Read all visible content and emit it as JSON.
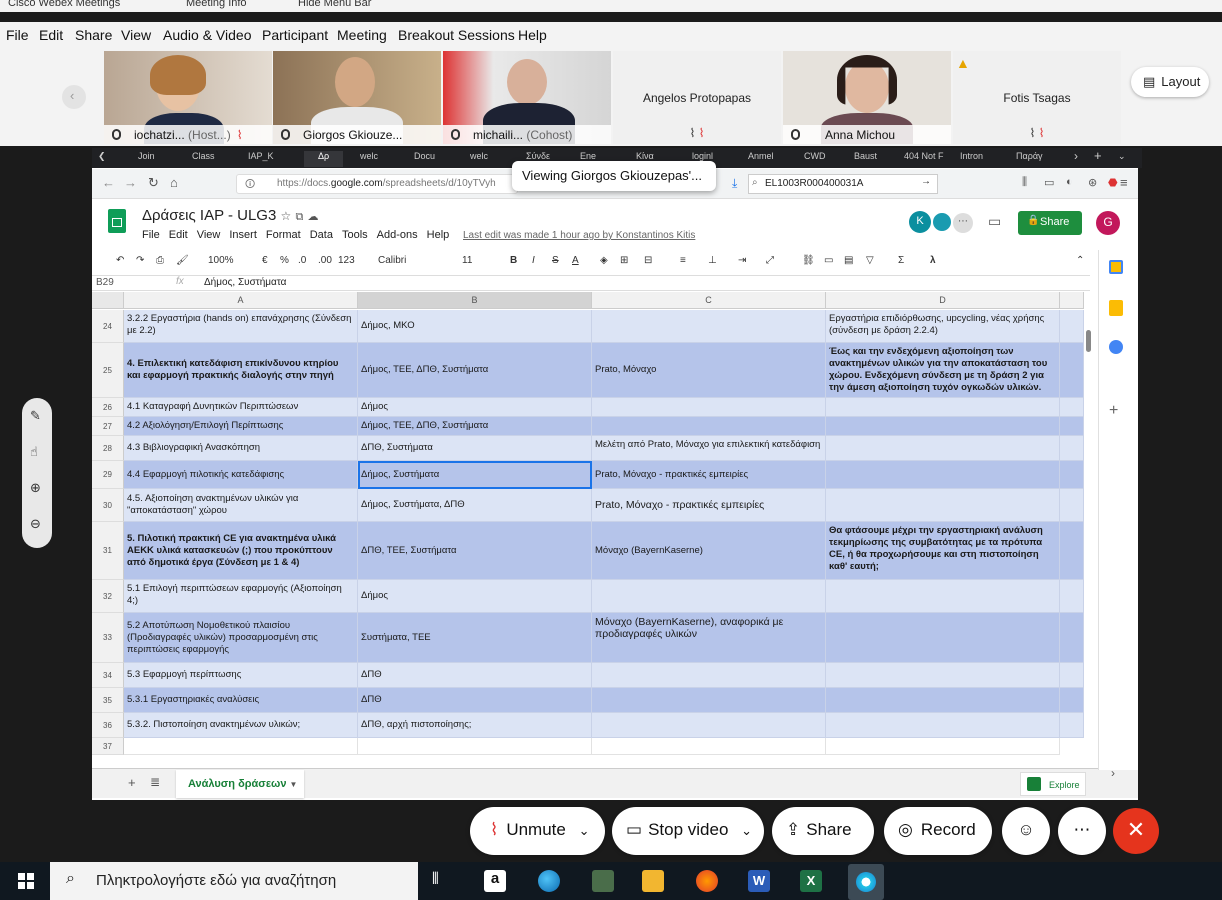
{
  "webex": {
    "app_title": "Cisco Webex Meetings",
    "meeting_info": "Meeting Info",
    "hide_menu": "Hide Menu Bar",
    "menu": [
      "File",
      "Edit",
      "Share",
      "View",
      "Audio & Video",
      "Participant",
      "Meeting",
      "Breakout Sessions",
      "Help"
    ],
    "participants": [
      {
        "name": "iochatzi...",
        "role": "(Host...)"
      },
      {
        "name": "Giorgos Gkiouze...",
        "role": ""
      },
      {
        "name": "michaili...",
        "role": "(Cohost)"
      },
      {
        "name": "Angelos Protopapas",
        "role": ""
      },
      {
        "name": "Anna Michou",
        "role": ""
      },
      {
        "name": "Fotis Tsagas",
        "role": ""
      }
    ],
    "layout_label": "Layout",
    "viewing_toast": "Viewing Giorgos Gkiouzepas'...",
    "controls": {
      "unmute": "Unmute",
      "stop_video": "Stop video",
      "share": "Share",
      "record": "Record"
    }
  },
  "browser": {
    "tabs": [
      "Join",
      "Class",
      "IAP_K",
      "Δρ",
      "welc",
      "Docu",
      "welc",
      "Σύνδε",
      "Ene",
      "Κίνα",
      "loginl",
      "Anmel",
      "CWD",
      "Baust",
      "404 Not F",
      "Intron",
      "Παράγ"
    ],
    "url_prefix": "https://docs.",
    "url_domain": "google.com",
    "url_rest": "/spreadsheets/d/10yTVyh",
    "search_value": "EL1003R000400031A"
  },
  "sheet": {
    "title": "Δράσεις IAP - ULG3",
    "menu": [
      "File",
      "Edit",
      "View",
      "Insert",
      "Format",
      "Data",
      "Tools",
      "Add-ons",
      "Help"
    ],
    "last_edit": "Last edit was made 1 hour ago by Konstantinos Kitis",
    "share_label": "Share",
    "user_initial": "G",
    "collaborators": [
      "K"
    ],
    "toolbar": {
      "zoom": "100%",
      "currency": "€",
      "percent": "%",
      "dec0": ".0",
      "dec1": ".00",
      "format": "123",
      "font": "Calibri",
      "size": "11"
    },
    "cell_ref": "B29",
    "formula": "Δήμος, Συστήματα",
    "columns": [
      "A",
      "B",
      "C",
      "D"
    ],
    "rows": [
      {
        "n": "24",
        "a": "3.2.2 Εργαστήρια (hands on) επανάχρησης (Σύνδεση με 2.2)",
        "b": "Δήμος, ΜΚΟ",
        "c": "",
        "d": "Εργαστήρια επιδιόρθωσης, upcycling, νέας χρήσης (σύνδεση με δράση 2.2.4)"
      },
      {
        "n": "25",
        "a": "4. Επιλεκτική κατεδάφιση επικίνδυνου κτηρίου και εφαρμογή πρακτικής διαλογής στην πηγή",
        "b": "Δήμος, ΤΕΕ, ΔΠΘ, Συστήματα",
        "c": "Prato, Μόναχο",
        "d": "Έως και την ενδεχόμενη αξιοποίηση των ανακτημένων υλικών για την αποκατάσταση του χώρου. Ενδεχόμενη σύνδεση με τη δράση 2 για την άμεση αξιοποίηση τυχόν ογκωδών υλικών."
      },
      {
        "n": "26",
        "a": "4.1 Καταγραφή Δυνητικών Περιπτώσεων",
        "b": "Δήμος",
        "c": "",
        "d": ""
      },
      {
        "n": "27",
        "a": "4.2 Αξιολόγηση/Επιλογή Περίπτωσης",
        "b": "Δήμος, ΤΕΕ, ΔΠΘ, Συστήματα",
        "c": "",
        "d": ""
      },
      {
        "n": "28",
        "a": "4.3 Βιβλιογραφική Ανασκόπηση",
        "b": "ΔΠΘ, Συστήματα",
        "c": "Μελέτη από Prato, Μόναχο για επιλεκτική κατεδάφιση",
        "d": ""
      },
      {
        "n": "29",
        "a": "4.4 Εφαρμογή πιλοτικής κατεδάφισης",
        "b": "Δήμος, Συστήματα",
        "c": "Prato, Μόναχο - πρακτικές εμπειρίες",
        "d": ""
      },
      {
        "n": "30",
        "a": "4.5. Αξιοποίηση ανακτημένων υλικών για \"αποκατάσταση\" χώρου",
        "b": "Δήμος, Συστήματα, ΔΠΘ",
        "c": "Prato, Μόναχο - πρακτικές εμπειρίες",
        "d": ""
      },
      {
        "n": "31",
        "a": "5. Πιλοτική πρακτική CE για ανακτημένα υλικά ΑΕΚΚ υλικά κατασκευών (;) που προκύπτουν από δημοτικά έργα (Σύνδεση με 1 & 4)",
        "b": "ΔΠΘ, ΤΕΕ, Συστήματα",
        "c": "Μόναχο (BayernKaserne)",
        "d": "Θα φτάσουμε μέχρι την εργαστηριακή ανάλυση τεκμηρίωσης της συμβατότητας με τα πρότυπα CE, ή θα προχωρήσουμε και στη πιστοποίηση καθ' εαυτή;"
      },
      {
        "n": "32",
        "a": "5.1 Επιλογή περιπτώσεων εφαρμογής (Αξιοποίηση 4;)",
        "b": "Δήμος",
        "c": "",
        "d": ""
      },
      {
        "n": "33",
        "a": "5.2 Αποτύπωση Νομοθετικού πλαισίου (Προδιαγραφές υλικών) προσαρμοσμένη στις περιπτώσεις εφαρμογής",
        "b": "Συστήματα, ΤΕΕ",
        "c": "Μόναχο (BayernKaserne), αναφορικά με προδιαγραφές υλικών",
        "d": ""
      },
      {
        "n": "34",
        "a": "5.3 Εφαρμογή περίπτωσης",
        "b": "ΔΠΘ",
        "c": "",
        "d": ""
      },
      {
        "n": "35",
        "a": "5.3.1 Εργαστηριακές αναλύσεις",
        "b": "ΔΠΘ",
        "c": "",
        "d": ""
      },
      {
        "n": "36",
        "a": "5.3.2. Πιστοποίηση ανακτημένων υλικών;",
        "b": "ΔΠΘ, αρχή πιστοποίησης;",
        "c": "",
        "d": ""
      },
      {
        "n": "37",
        "a": "",
        "b": "",
        "c": "",
        "d": ""
      }
    ],
    "sheet_tab": "Ανάλυση δράσεων",
    "explore": "Explore"
  },
  "taskbar": {
    "search_placeholder": "Πληκτρολογήστε εδώ για αναζήτηση"
  }
}
